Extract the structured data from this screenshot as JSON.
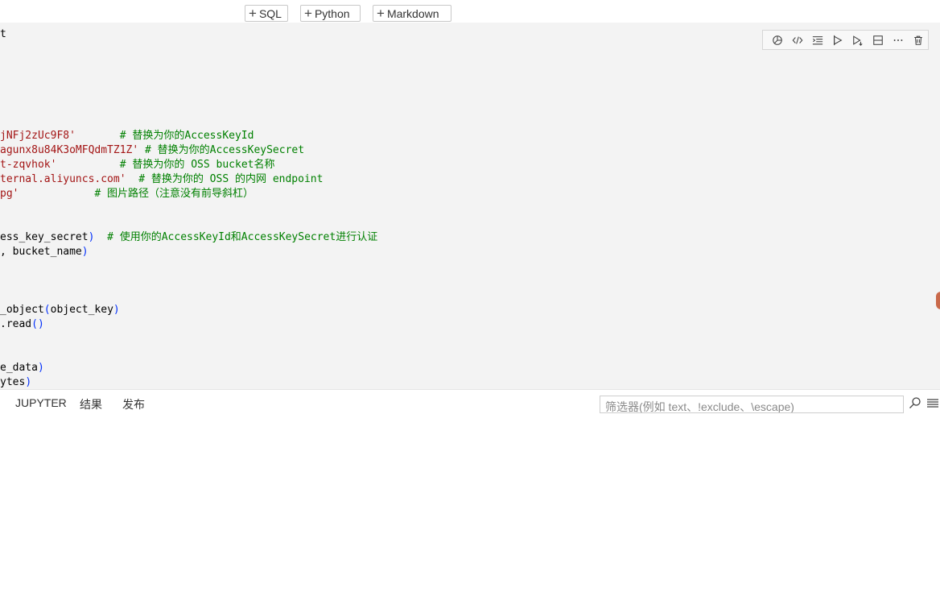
{
  "add_bar": {
    "sql_label": "SQL",
    "python_label": "Python",
    "markdown_label": "Markdown"
  },
  "cell_toolbar": {
    "icons": [
      "variables-icon",
      "code-icon",
      "outline-icon",
      "run-above-icon",
      "run-below-icon",
      "split-cell-icon",
      "more-icon",
      "delete-icon"
    ]
  },
  "code_lines": [
    {
      "parts": [
        {
          "t": "t",
          "k": ""
        }
      ]
    },
    {
      "parts": []
    },
    {
      "parts": []
    },
    {
      "parts": []
    },
    {
      "parts": []
    },
    {
      "parts": []
    },
    {
      "parts": []
    },
    {
      "parts": [
        {
          "t": "jNFj2zUc9F8'",
          "k": "s"
        },
        {
          "t": "       ",
          "k": ""
        },
        {
          "t": "# 替换为你的AccessKeyId",
          "k": "c"
        }
      ]
    },
    {
      "parts": [
        {
          "t": "agunx8u84K3oMFQdmTZ1Z'",
          "k": "s"
        },
        {
          "t": " ",
          "k": ""
        },
        {
          "t": "# 替换为你的AccessKeySecret",
          "k": "c"
        }
      ]
    },
    {
      "parts": [
        {
          "t": "t-zqvhok'",
          "k": "s"
        },
        {
          "t": "          ",
          "k": ""
        },
        {
          "t": "# 替换为你的 OSS bucket名称",
          "k": "c"
        }
      ]
    },
    {
      "parts": [
        {
          "t": "ternal.aliyuncs.com'",
          "k": "s"
        },
        {
          "t": "  ",
          "k": ""
        },
        {
          "t": "# 替换为你的 OSS 的内网 endpoint",
          "k": "c"
        }
      ]
    },
    {
      "parts": [
        {
          "t": "pg'",
          "k": "s"
        },
        {
          "t": "            ",
          "k": ""
        },
        {
          "t": "# 图片路径（注意没有前导斜杠）",
          "k": "c"
        }
      ]
    },
    {
      "parts": []
    },
    {
      "parts": []
    },
    {
      "parts": [
        {
          "t": "ess_key_secret",
          "k": ""
        },
        {
          "t": ")",
          "k": "p"
        },
        {
          "t": "  ",
          "k": ""
        },
        {
          "t": "# 使用你的AccessKeyId和AccessKeySecret进行认证",
          "k": "c"
        }
      ]
    },
    {
      "parts": [
        {
          "t": ", bucket_name",
          "k": ""
        },
        {
          "t": ")",
          "k": "p"
        }
      ]
    },
    {
      "parts": []
    },
    {
      "parts": []
    },
    {
      "parts": []
    },
    {
      "parts": [
        {
          "t": "_object",
          "k": ""
        },
        {
          "t": "(",
          "k": "p"
        },
        {
          "t": "object_key",
          "k": ""
        },
        {
          "t": ")",
          "k": "p"
        }
      ]
    },
    {
      "parts": [
        {
          "t": ".read",
          "k": ""
        },
        {
          "t": "()",
          "k": "p"
        }
      ]
    },
    {
      "parts": []
    },
    {
      "parts": []
    },
    {
      "parts": [
        {
          "t": "e_data",
          "k": ""
        },
        {
          "t": ")",
          "k": "p"
        }
      ]
    },
    {
      "parts": [
        {
          "t": "ytes",
          "k": ""
        },
        {
          "t": ")",
          "k": "p"
        }
      ]
    }
  ],
  "panel": {
    "tab_jupyter": "JUPYTER",
    "tab_results": "结果",
    "tab_publish": "发布",
    "filter_placeholder": "筛选器(例如 text、!exclude、\\escape)"
  }
}
